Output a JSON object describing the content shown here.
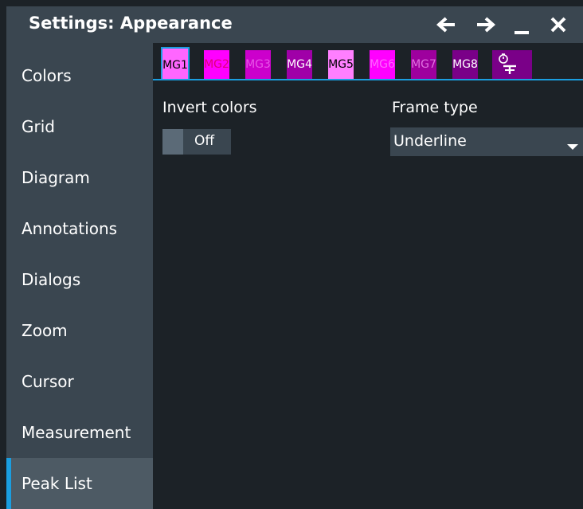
{
  "window": {
    "title": "Settings: Appearance",
    "controls": [
      "back-arrow-icon",
      "forward-arrow-icon",
      "minimize-icon",
      "close-icon"
    ]
  },
  "sidebar": {
    "items": [
      {
        "label": "Colors",
        "active": false
      },
      {
        "label": "Grid",
        "active": false
      },
      {
        "label": "Diagram",
        "active": false
      },
      {
        "label": "Annotations",
        "active": false
      },
      {
        "label": "Dialogs",
        "active": false
      },
      {
        "label": "Zoom",
        "active": false
      },
      {
        "label": "Cursor",
        "active": false
      },
      {
        "label": "Measurement",
        "active": false
      },
      {
        "label": "Peak List",
        "active": true
      }
    ]
  },
  "tabs": [
    {
      "label": "MG1",
      "bg": "#ff66ff",
      "fg": "#000000",
      "selected": true
    },
    {
      "label": "MG2",
      "bg": "#ff00ff",
      "fg": "#e0007a",
      "selected": false
    },
    {
      "label": "MG3",
      "bg": "#cc00cc",
      "fg": "#e855e8",
      "selected": false
    },
    {
      "label": "MG4",
      "bg": "#a000a8",
      "fg": "#ffffff",
      "selected": false
    },
    {
      "label": "MG5",
      "bg": "#ff7fff",
      "fg": "#000000",
      "selected": false
    },
    {
      "label": "MG6",
      "bg": "#ff00ff",
      "fg": "#ff66ff",
      "selected": false
    },
    {
      "label": "MG7",
      "bg": "#9e009e",
      "fg": "#e070e0",
      "selected": false
    },
    {
      "label": "MG8",
      "bg": "#7a0088",
      "fg": "#ffffff",
      "selected": false
    },
    {
      "label": "",
      "icon": "timer-tool-icon",
      "bg": "#7a0088",
      "fg": "#ffffff",
      "selected": false
    }
  ],
  "invert_colors": {
    "label": "Invert colors",
    "value": "Off"
  },
  "frame_type": {
    "label": "Frame type",
    "value": "Underline"
  },
  "colors": {
    "accent": "#1a9ee0",
    "panel": "#3a4650",
    "background": "#1c2227"
  }
}
